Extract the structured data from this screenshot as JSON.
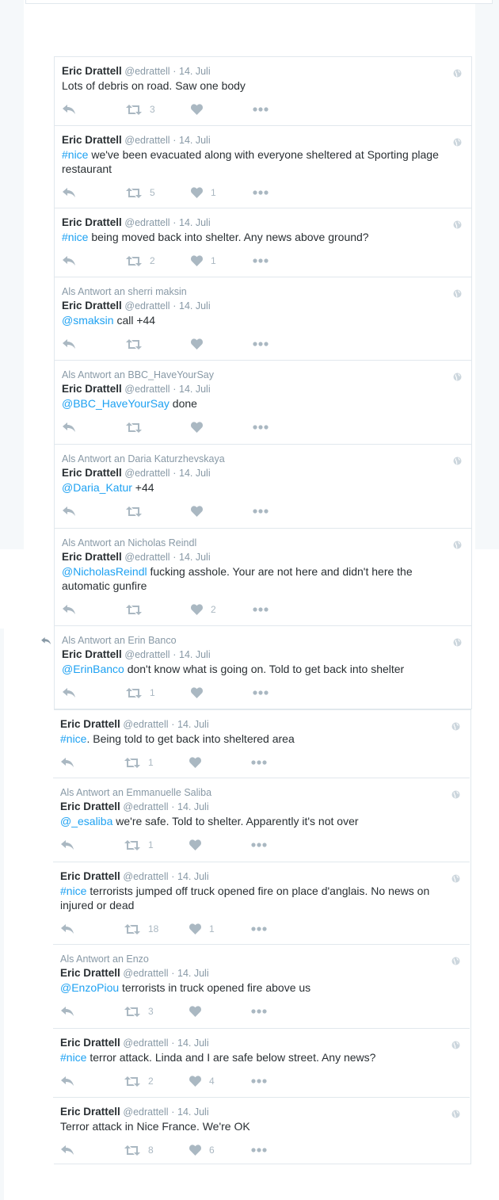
{
  "author": {
    "name": "Eric Drattell",
    "handle": "@edrattell",
    "date": "14. Juli",
    "separator": "·"
  },
  "colors": {
    "link": "#1da1f2",
    "text": "#292f33",
    "muted": "#8899a6",
    "icon": "#aab8c2",
    "border": "#e1e8ed"
  },
  "icons": {
    "reply": "reply-icon",
    "retweet": "retweet-icon",
    "like": "heart-icon",
    "more": "more-icon",
    "visibility": "globe-icon"
  },
  "tweets": [
    {
      "reply_to": "",
      "hashtag": "",
      "text": "Lots of debris on road. Saw one body",
      "retweets": "3",
      "likes": ""
    },
    {
      "reply_to": "",
      "hashtag": "#nice",
      "text": " we've been evacuated along with everyone sheltered at Sporting plage restaurant",
      "retweets": "5",
      "likes": "1"
    },
    {
      "reply_to": "",
      "hashtag": "#nice",
      "text": " being moved back into shelter. Any news above ground?",
      "retweets": "2",
      "likes": "1"
    },
    {
      "reply_to": "Als Antwort an sherri maksin",
      "hashtag": "@smaksin",
      "text": " call +44",
      "retweets": "",
      "likes": ""
    },
    {
      "reply_to": "Als Antwort an BBC_HaveYourSay",
      "hashtag": "@BBC_HaveYourSay",
      "text": " done",
      "retweets": "",
      "likes": ""
    },
    {
      "reply_to": "Als Antwort an Daria Katurzhevskaya",
      "hashtag": "@Daria_Katur",
      "text": " +44",
      "retweets": "",
      "likes": ""
    },
    {
      "reply_to": "Als Antwort an Nicholas Reindl",
      "hashtag": "@NicholasReindl",
      "text": " fucking asshole. Your are not here and didn't here the automatic gunfire",
      "retweets": "",
      "likes": "2"
    },
    {
      "reply_to": "Als Antwort an Erin Banco",
      "hashtag": "@ErinBanco",
      "text": " don't know what is going on. Told to get back into shelter",
      "retweets": "1",
      "likes": ""
    },
    {
      "reply_to": "",
      "hashtag": "#nice",
      "text": ". Being told to get back into sheltered area",
      "retweets": "1",
      "likes": ""
    },
    {
      "reply_to": "Als Antwort an Emmanuelle Saliba",
      "hashtag": "@_esaliba",
      "text": " we're safe. Told to shelter. Apparently it's not over",
      "retweets": "1",
      "likes": ""
    },
    {
      "reply_to": "",
      "hashtag": "#nice",
      "text": " terrorists jumped off truck opened fire on place d'anglais. No news on injured or dead",
      "retweets": "18",
      "likes": "1"
    },
    {
      "reply_to": "Als Antwort an Enzo",
      "hashtag": "@EnzoPiou",
      "text": " terrorists in truck opened fire above us",
      "retweets": "3",
      "likes": ""
    },
    {
      "reply_to": "",
      "hashtag": "#nice",
      "text": " terror attack. Linda and I are safe below street. Any news?",
      "retweets": "2",
      "likes": "4"
    },
    {
      "reply_to": "",
      "hashtag": "",
      "text": "Terror attack in Nice France. We're OK",
      "retweets": "8",
      "likes": "6"
    }
  ]
}
